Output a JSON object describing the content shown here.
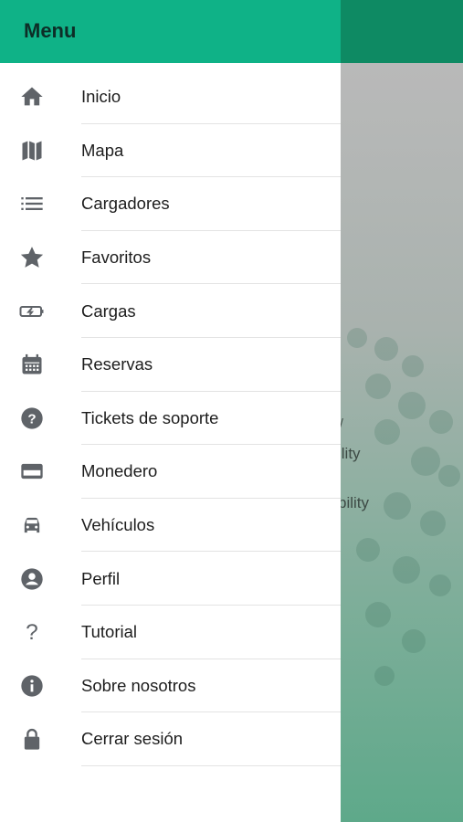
{
  "drawer": {
    "title": "Menu",
    "items": [
      {
        "label": "Inicio",
        "icon": "home-icon"
      },
      {
        "label": "Mapa",
        "icon": "map-icon"
      },
      {
        "label": "Cargadores",
        "icon": "list-icon"
      },
      {
        "label": "Favoritos",
        "icon": "star-icon"
      },
      {
        "label": "Cargas",
        "icon": "battery-charging-icon"
      },
      {
        "label": "Reservas",
        "icon": "calendar-icon"
      },
      {
        "label": "Tickets de soporte",
        "icon": "help-circle-icon"
      },
      {
        "label": "Monedero",
        "icon": "credit-card-icon"
      },
      {
        "label": "Vehículos",
        "icon": "car-icon"
      },
      {
        "label": "Perfil",
        "icon": "account-circle-icon"
      },
      {
        "label": "Tutorial",
        "icon": "question-mark-icon"
      },
      {
        "label": "Sobre nosotros",
        "icon": "info-icon"
      },
      {
        "label": "Cerrar sesión",
        "icon": "lock-icon"
      }
    ]
  },
  "background": {
    "partial_text_1": "/",
    "partial_text_2": "ility",
    "partial_text_3": "bility"
  },
  "colors": {
    "header": "#0fb287",
    "background_header": "#0e8a63",
    "icon": "#5f6368"
  }
}
